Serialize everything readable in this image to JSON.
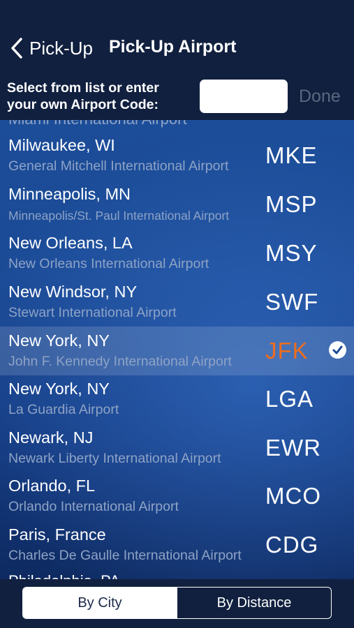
{
  "nav": {
    "back_label": "Pick-Up",
    "title": "Pick-Up Airport"
  },
  "entry": {
    "prompt_line1": "Select from list or enter",
    "prompt_line2": "your own Airport Code:",
    "code_value": "",
    "done_label": "Done"
  },
  "list": {
    "top_partial": "Miami International Airport",
    "bottom_partial": "Philadelphia, PA",
    "items": [
      {
        "city": "Milwaukee, WI",
        "airport": "General Mitchell International Airport",
        "code": "MKE"
      },
      {
        "city": "Minneapolis, MN",
        "airport": "Minneapolis/St. Paul International Airport",
        "code": "MSP"
      },
      {
        "city": "New Orleans, LA",
        "airport": "New Orleans International Airport",
        "code": "MSY"
      },
      {
        "city": "New Windsor, NY",
        "airport": "Stewart International Airport",
        "code": "SWF"
      },
      {
        "city": "New York, NY",
        "airport": "John F. Kennedy International Airport",
        "code": "JFK",
        "selected": true
      },
      {
        "city": "New York, NY",
        "airport": "La Guardia Airport",
        "code": "LGA"
      },
      {
        "city": "Newark, NJ",
        "airport": "Newark Liberty International Airport",
        "code": "EWR"
      },
      {
        "city": "Orlando, FL",
        "airport": "Orlando International Airport",
        "code": "MCO"
      },
      {
        "city": "Paris, France",
        "airport": "Charles De Gaulle International Airport",
        "code": "CDG"
      }
    ]
  },
  "sort": {
    "by_city": "By City",
    "by_distance": "By Distance"
  },
  "colors": {
    "selected_code": "#ec6d1f",
    "header_bg": "#11203f"
  },
  "icons": {
    "back": "chevron-left-icon",
    "selected": "checkmark-circle-icon"
  }
}
